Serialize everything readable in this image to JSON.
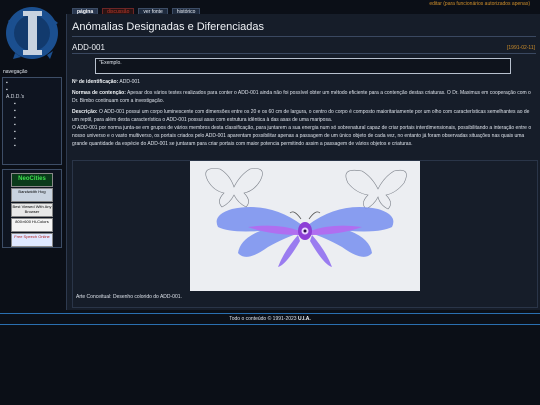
{
  "top": {
    "tabs": [
      "página",
      "discussão",
      "ver fonte",
      "histórico"
    ],
    "right_link": "editar (para funcionários autorizados apenas)"
  },
  "sidebar": {
    "nav_title": "navegação",
    "items": [
      {
        "label": ""
      },
      {
        "label": ""
      },
      {
        "label": "A.D.D.'s"
      }
    ],
    "subitems": [
      "",
      "",
      "",
      "",
      "",
      "",
      ""
    ],
    "badges": [
      "NeoCities",
      "Bandwidth Hog",
      "Best Viewed With Any Browser",
      "800×600 Hi-Colors",
      "Free Speech Online"
    ]
  },
  "main": {
    "page_title": "Anómalias Designadas e Diferenciadas",
    "item_title": "ADD-001",
    "item_date": "[1991-02-11]",
    "quote": "\"Exemplo.",
    "id_label": "Nº de identificação:",
    "id_value": " ADD-001",
    "norms_label": "Normas de contenção:",
    "norms_text": " Apesar dos vários testes realizados para conter o ADD-001 ainda não foi possível obter um método eficiente para a contenção destas criaturas. O Dr. Maximus em cooperação com o Dr. Bimbo continuam com a investigação.",
    "desc_label": "Descrição:",
    "desc_text": " O ADD-001 possui um corpo luminescente com dimensões entre os 20 e os 60 cm de largura, o centro do corpo é composto maioritariamente por um olho com características semelhantes ao de um reptil, para além desta característica o ADD-001 possui asas com estrutura idêntica à das asas de uma mariposa.",
    "desc_text2": "O ADD-001 por norma junta-se em grupos de vários membros desta classificação, para juntarem a sua energia num só sobrenatural capaz de criar portais interdimensionais, possibilitando a interação entre o nosso universo e o vasto multiverso, os portais criados pelo ADD-001 aparentam possibilitar apenas a passagem de um único objeto de cada vez, no entanto já foram observadas situações nas quais uma grande quantidade da espécie do ADD-001 se juntaram para criar portais com maior potencia permitindo assim a passagem de vários objetos e criaturas.",
    "caption": "Arte Conceitual: Desenho colorido do ADD-001."
  },
  "footer": {
    "text": "Todo o conteúdo © 1991-2023 ",
    "bold": "U.I.A."
  },
  "colors": {
    "accent": "#d08f2a",
    "link": "#3b6fb7",
    "wing": "#8a63e8"
  }
}
